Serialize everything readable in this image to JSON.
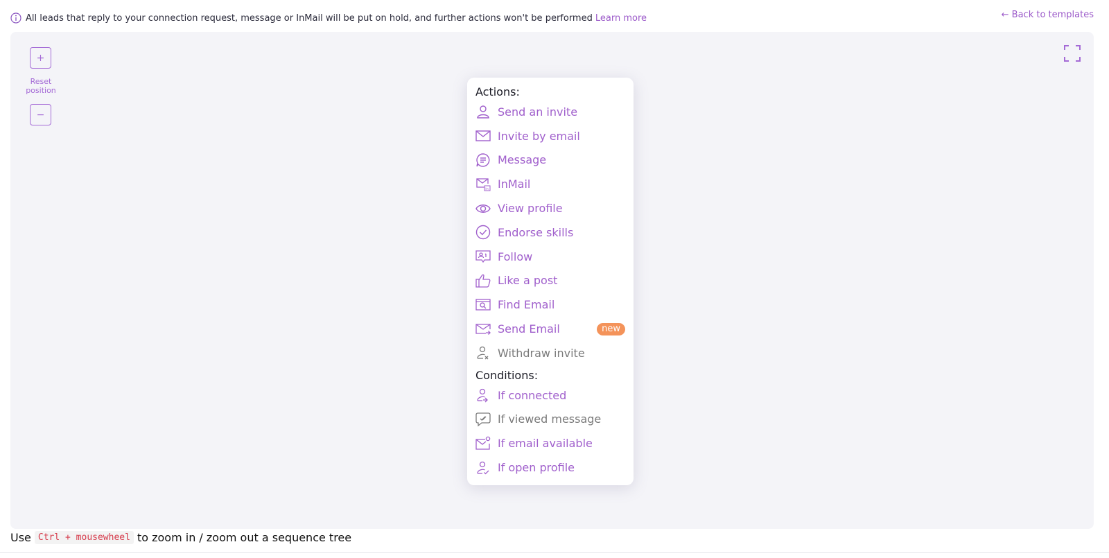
{
  "banner": {
    "text": "All leads that reply to your connection request, message or InMail will be put on hold, and further actions won't be performed",
    "link": "Learn more"
  },
  "back_link": "← Back to templates",
  "zoom": {
    "in_label": "+",
    "out_label": "−",
    "reset_label": "Reset position"
  },
  "menu": {
    "actions_title": "Actions:",
    "conditions_title": "Conditions:",
    "actions": [
      {
        "label": "Send an invite",
        "icon": "person-icon",
        "enabled": true
      },
      {
        "label": "Invite by email",
        "icon": "envelope-icon",
        "enabled": true
      },
      {
        "label": "Message",
        "icon": "chat-icon",
        "enabled": true
      },
      {
        "label": "InMail",
        "icon": "inmail-icon",
        "enabled": true
      },
      {
        "label": "View profile",
        "icon": "eye-icon",
        "enabled": true
      },
      {
        "label": "Endorse skills",
        "icon": "check-circle-icon",
        "enabled": true
      },
      {
        "label": "Follow",
        "icon": "follow-icon",
        "enabled": true
      },
      {
        "label": "Like a post",
        "icon": "thumbs-up-icon",
        "enabled": true
      },
      {
        "label": "Find Email",
        "icon": "find-email-icon",
        "enabled": true
      },
      {
        "label": "Send Email",
        "icon": "send-email-icon",
        "enabled": true,
        "badge": "new"
      },
      {
        "label": "Withdraw invite",
        "icon": "withdraw-person-icon",
        "enabled": false
      }
    ],
    "conditions": [
      {
        "label": "If connected",
        "icon": "person-link-icon",
        "enabled": true
      },
      {
        "label": "If viewed message",
        "icon": "viewed-message-icon",
        "enabled": false
      },
      {
        "label": "If email available",
        "icon": "email-dot-icon",
        "enabled": true
      },
      {
        "label": "If open profile",
        "icon": "person-check-icon",
        "enabled": true
      }
    ]
  },
  "hint": {
    "before": "Use",
    "code": "Ctrl + mousewheel",
    "after": "to zoom in / zoom out a sequence tree"
  },
  "colors": {
    "accent": "#a05fcc",
    "disabled": "#7a7a7a",
    "badge": "#f4935a",
    "canvas": "#f4f4f8"
  }
}
